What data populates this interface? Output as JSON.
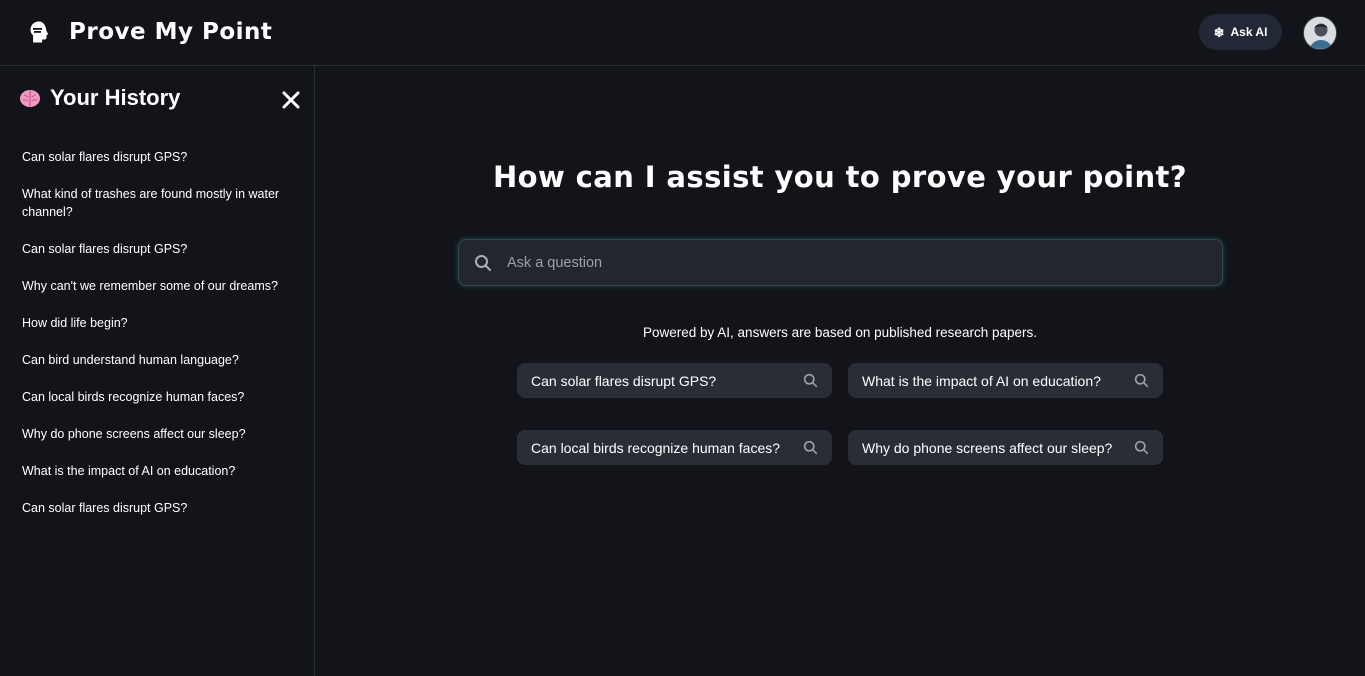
{
  "header": {
    "brand": "Prove My Point",
    "ask_ai_label": "Ask AI"
  },
  "sidebar": {
    "title": "Your History",
    "items": [
      "Can solar flares disrupt GPS?",
      "What kind of trashes are found mostly in water channel?",
      "Can solar flares disrupt GPS?",
      "Why can't we remember some of our dreams?",
      "How did life begin?",
      "Can bird understand human language?",
      "Can local birds recognize human faces?",
      "Why do phone screens affect our sleep?",
      "What is the impact of AI on education?",
      "Can solar flares disrupt GPS?"
    ]
  },
  "main": {
    "title": "How can I assist you to prove your point?",
    "search": {
      "placeholder": "Ask a question",
      "value": ""
    },
    "powered_text": "Powered by AI, answers are based on published research papers.",
    "suggestions": [
      "Can solar flares disrupt GPS?",
      "What is the impact of AI on education?",
      "Can local birds recognize human faces?",
      "Why do phone screens affect our sleep?"
    ]
  },
  "colors": {
    "background": "#121419",
    "chip": "#2a2d35",
    "ask_ai_bg": "#232837",
    "search_glow": "#3cb4aa"
  },
  "icons": {
    "logo": "head-silhouette-icon",
    "ask_ai": "sparkle-icon",
    "history": "brain-icon",
    "close": "close-icon",
    "search": "search-icon"
  }
}
